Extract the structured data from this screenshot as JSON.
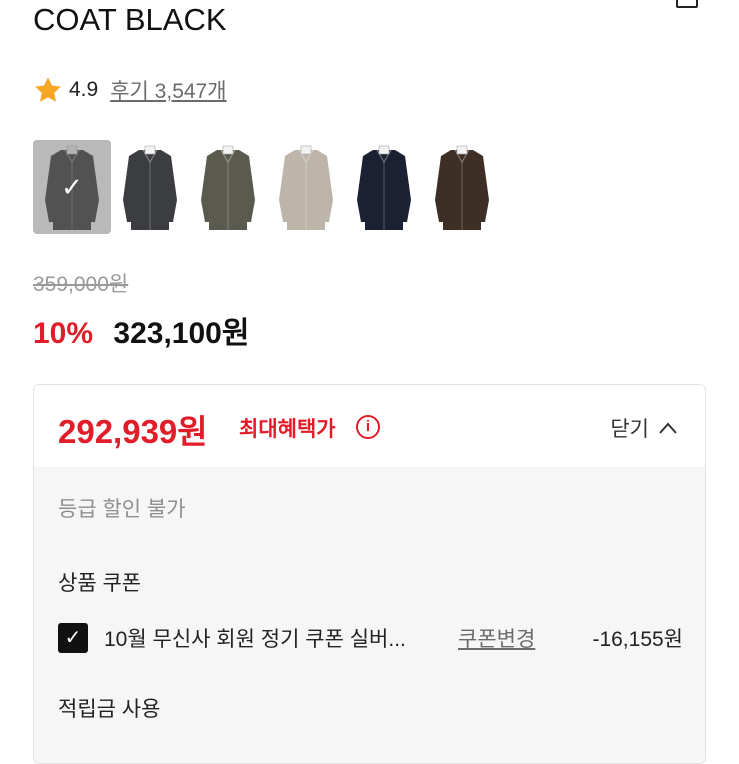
{
  "product": {
    "title": "COAT BLACK"
  },
  "rating": {
    "icon": "star-icon",
    "value": "4.9",
    "reviews_label": "후기 3,547개"
  },
  "swatches": [
    {
      "color": "#1b1b1b",
      "selected": true
    },
    {
      "color": "#3c3d40",
      "selected": false
    },
    {
      "color": "#5a5a4e",
      "selected": false
    },
    {
      "color": "#bdb5aa",
      "selected": false
    },
    {
      "color": "#1b2133",
      "selected": false
    },
    {
      "color": "#3d2f26",
      "selected": false
    }
  ],
  "pricing": {
    "original": "359,000원",
    "discount": "10%",
    "sale": "323,100원"
  },
  "benefit": {
    "best_price": "292,939원",
    "best_label": "최대혜택가",
    "info_icon": "info-icon",
    "close_label": "닫기",
    "grade_note": "등급 할인 불가",
    "coupon_heading": "상품 쿠폰",
    "coupon": {
      "checked": true,
      "name": "10월 무신사 회원 정기 쿠폰 실버...",
      "change_label": "쿠폰변경",
      "amount": "-16,155원"
    },
    "points_heading": "적립금 사용"
  },
  "colors": {
    "accent_red": "#e11d2a",
    "muted_text": "#8f8f8f",
    "panel_bg": "#f6f6f6"
  }
}
